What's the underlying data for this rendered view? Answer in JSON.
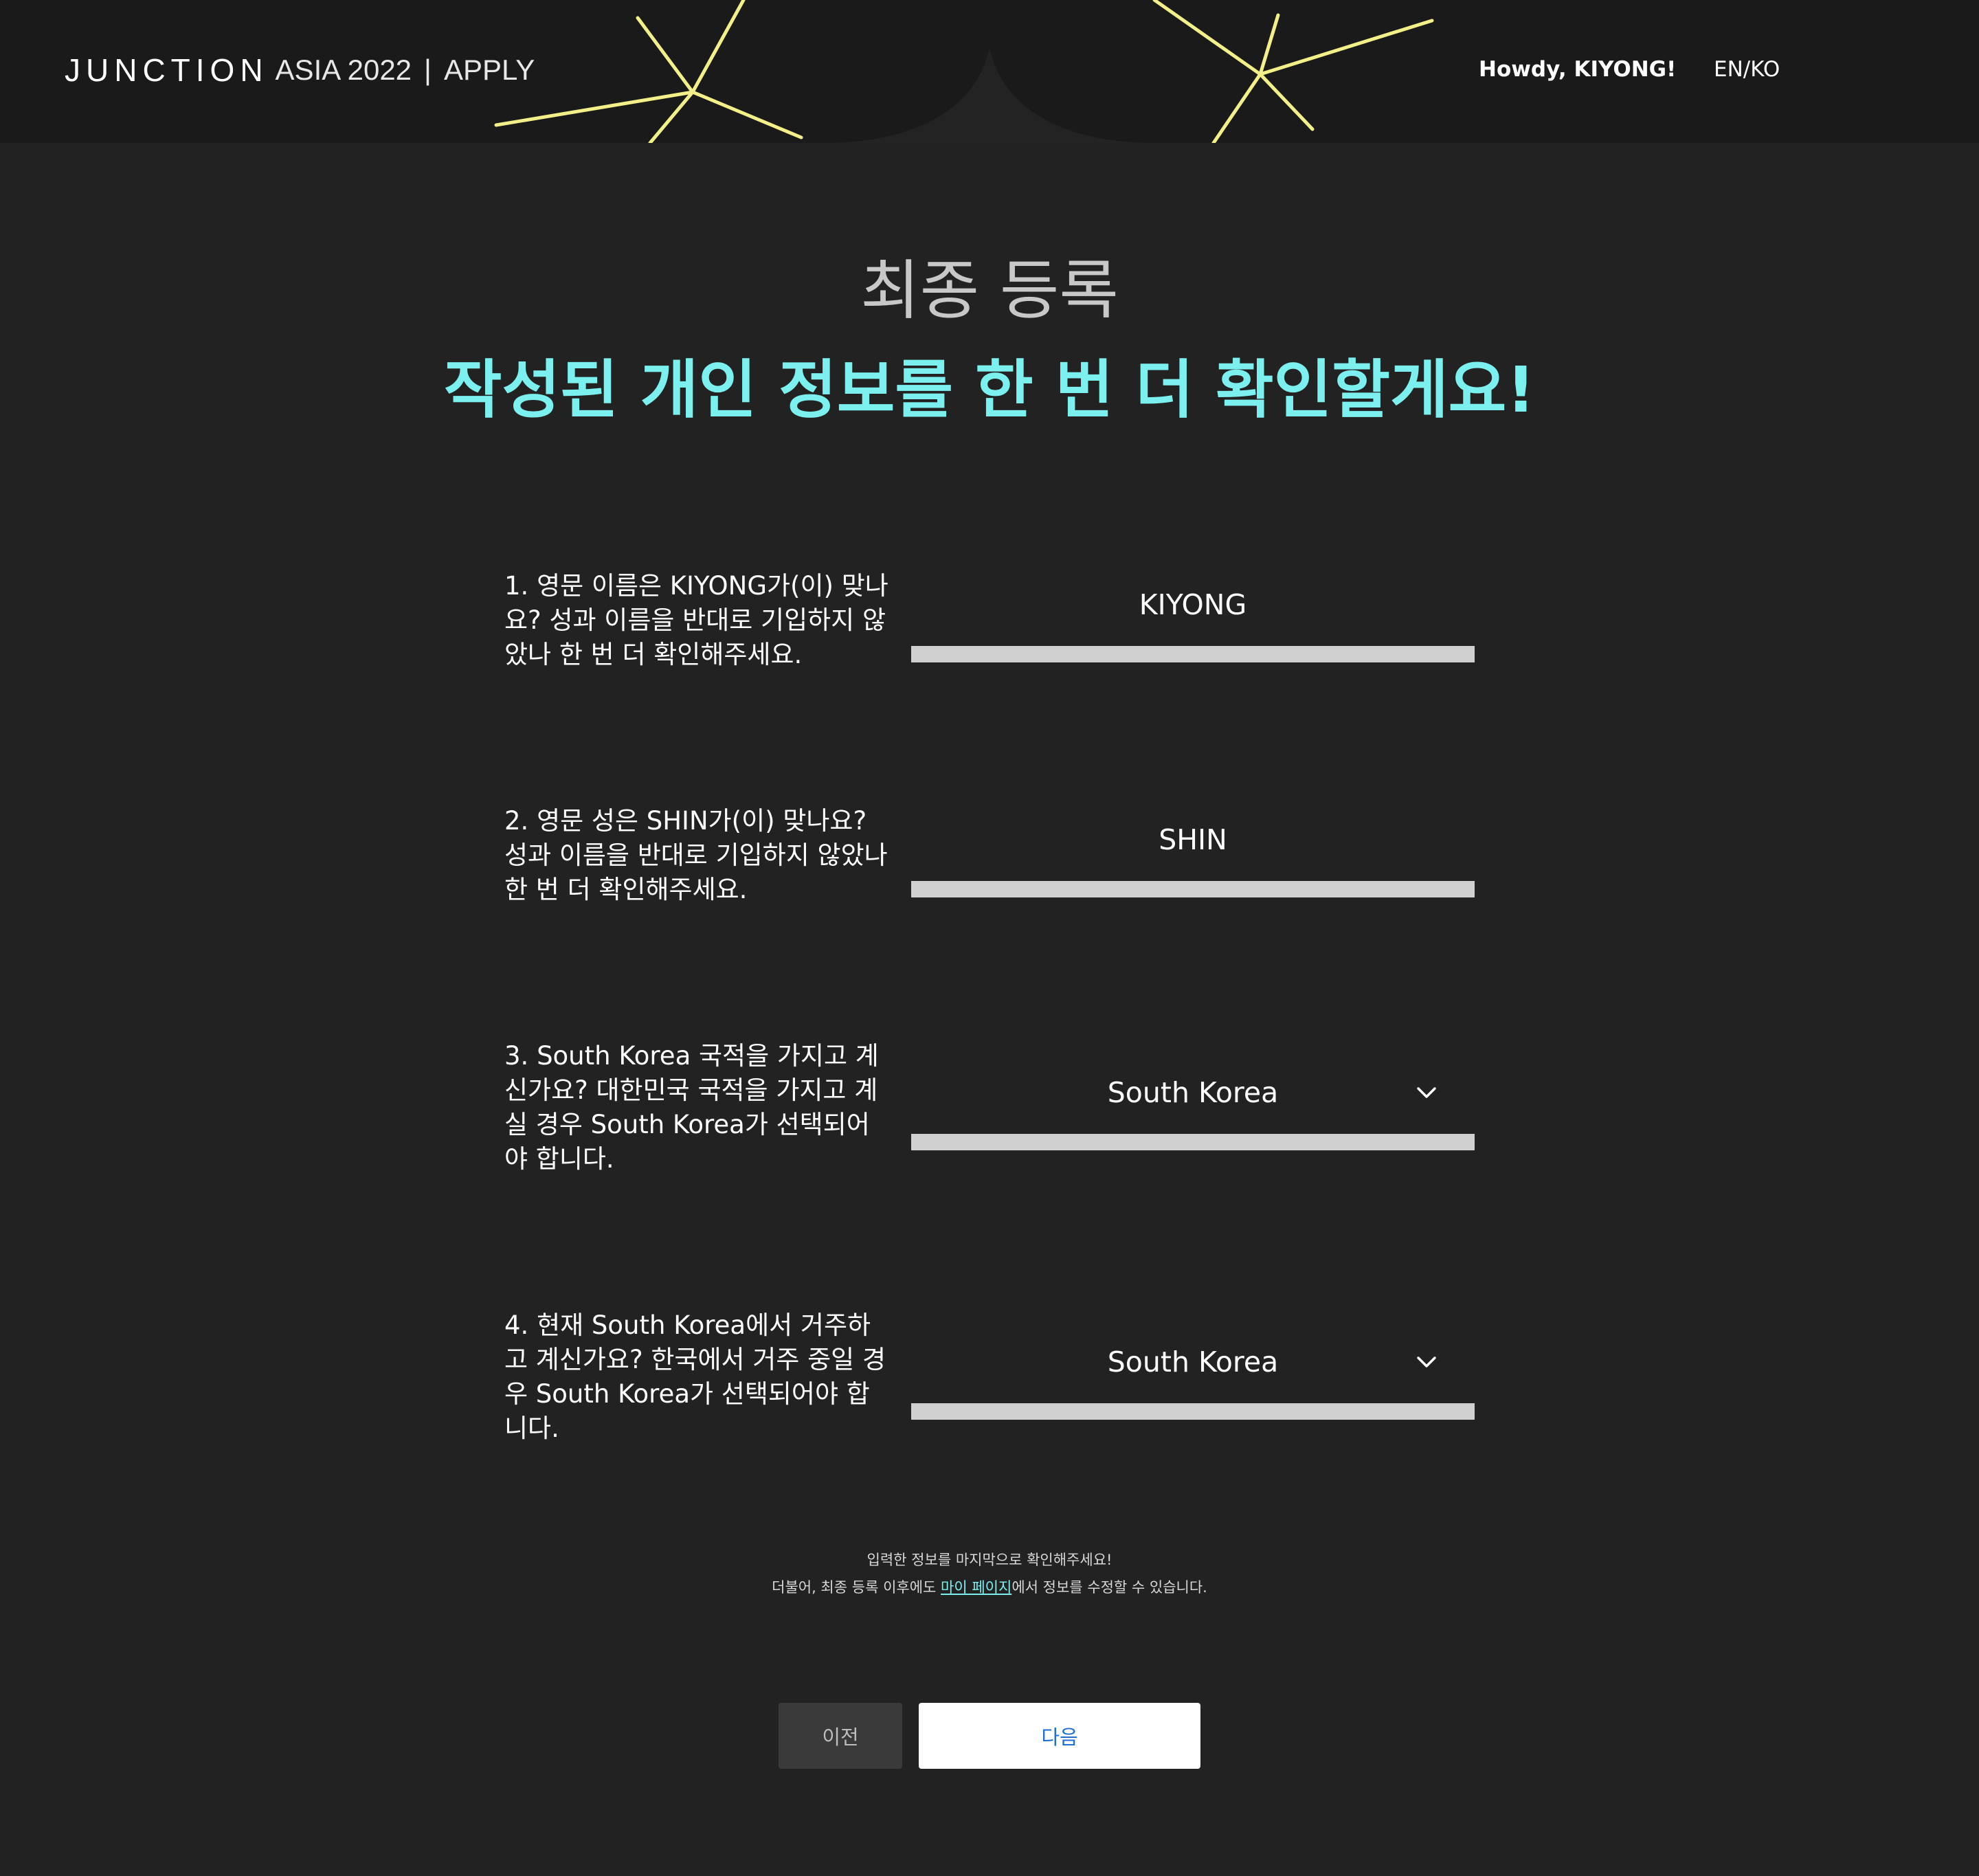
{
  "header": {
    "brand_primary": "JUNCTION",
    "brand_event": "ASIA 2022",
    "brand_separator": "|",
    "brand_section": "APPLY",
    "greeting": "Howdy, KIYONG!",
    "language_toggle": "EN/KO",
    "decoration_color": "#f3f08a"
  },
  "page": {
    "step_title": "최종 등록",
    "heading": "작성된 개인 정보를 한 번 더 확인할게요!",
    "heading_color": "#7cf0ee"
  },
  "questions": [
    {
      "label": "1. 영문 이름은 KIYONG가(이) 맞나요? 성과 이름을 반대로 기입하지 않았나 한 번 더 확인해주세요.",
      "value": "KIYONG",
      "type": "text"
    },
    {
      "label": "2. 영문 성은 SHIN가(이) 맞나요? 성과 이름을 반대로 기입하지 않았나 한 번 더 확인해주세요.",
      "value": "SHIN",
      "type": "text"
    },
    {
      "label": "3. South Korea 국적을 가지고 계신가요? 대한민국 국적을 가지고 계실 경우 South Korea가 선택되어야 합니다.",
      "value": "South Korea",
      "type": "select"
    },
    {
      "label": "4. 현재 South Korea에서 거주하고 계신가요? 한국에서 거주 중일 경우 South Korea가 선택되어야 합니다.",
      "value": "South Korea",
      "type": "select"
    }
  ],
  "notice": {
    "line1": "입력한 정보를 마지막으로 확인해주세요!",
    "line2_before": "더불어, 최종 등록 이후에도 ",
    "line2_link": "마이 페이지",
    "line2_after": "에서 정보를 수정할 수 있습니다."
  },
  "buttons": {
    "prev": "이전",
    "next": "다음"
  }
}
